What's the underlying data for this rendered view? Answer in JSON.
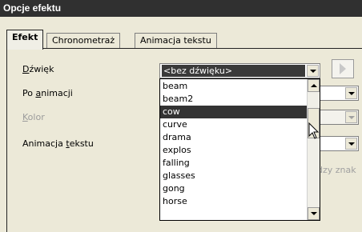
{
  "window": {
    "title": "Opcje efektu"
  },
  "tabs": [
    {
      "label": "Efekt",
      "active": true
    },
    {
      "label": "Chronometraż",
      "active": false
    },
    {
      "label": "Animacja tekstu",
      "active": false
    }
  ],
  "fields": {
    "sound": {
      "label_pre": "",
      "label_u": "D",
      "label_post": "źwięk",
      "value": "<bez dźwięku>"
    },
    "after_animation": {
      "label_pre": "Po ",
      "label_u": "a",
      "label_post": "nimacji"
    },
    "color": {
      "label_pre": "",
      "label_u": "K",
      "label_post": "olor"
    },
    "text_animation": {
      "label_pre": "Animacja ",
      "label_u": "t",
      "label_post": "ekstu"
    }
  },
  "sound_list": {
    "items": [
      "beam",
      "beam2",
      "cow",
      "curve",
      "drama",
      "explos",
      "falling",
      "glasses",
      "gong",
      "horse"
    ],
    "highlighted": "cow"
  },
  "partial_text": "dzy znak",
  "icons": {
    "play": "play-icon",
    "dropdown": "chevron-down-icon",
    "scroll_up": "scroll-up-arrow-icon",
    "scroll_down": "scroll-down-arrow-icon",
    "cursor": "mouse-cursor-icon"
  },
  "colors": {
    "title_bg": "#303030",
    "selection_bg": "#333333",
    "dialog_bg": "#ece9d8"
  }
}
